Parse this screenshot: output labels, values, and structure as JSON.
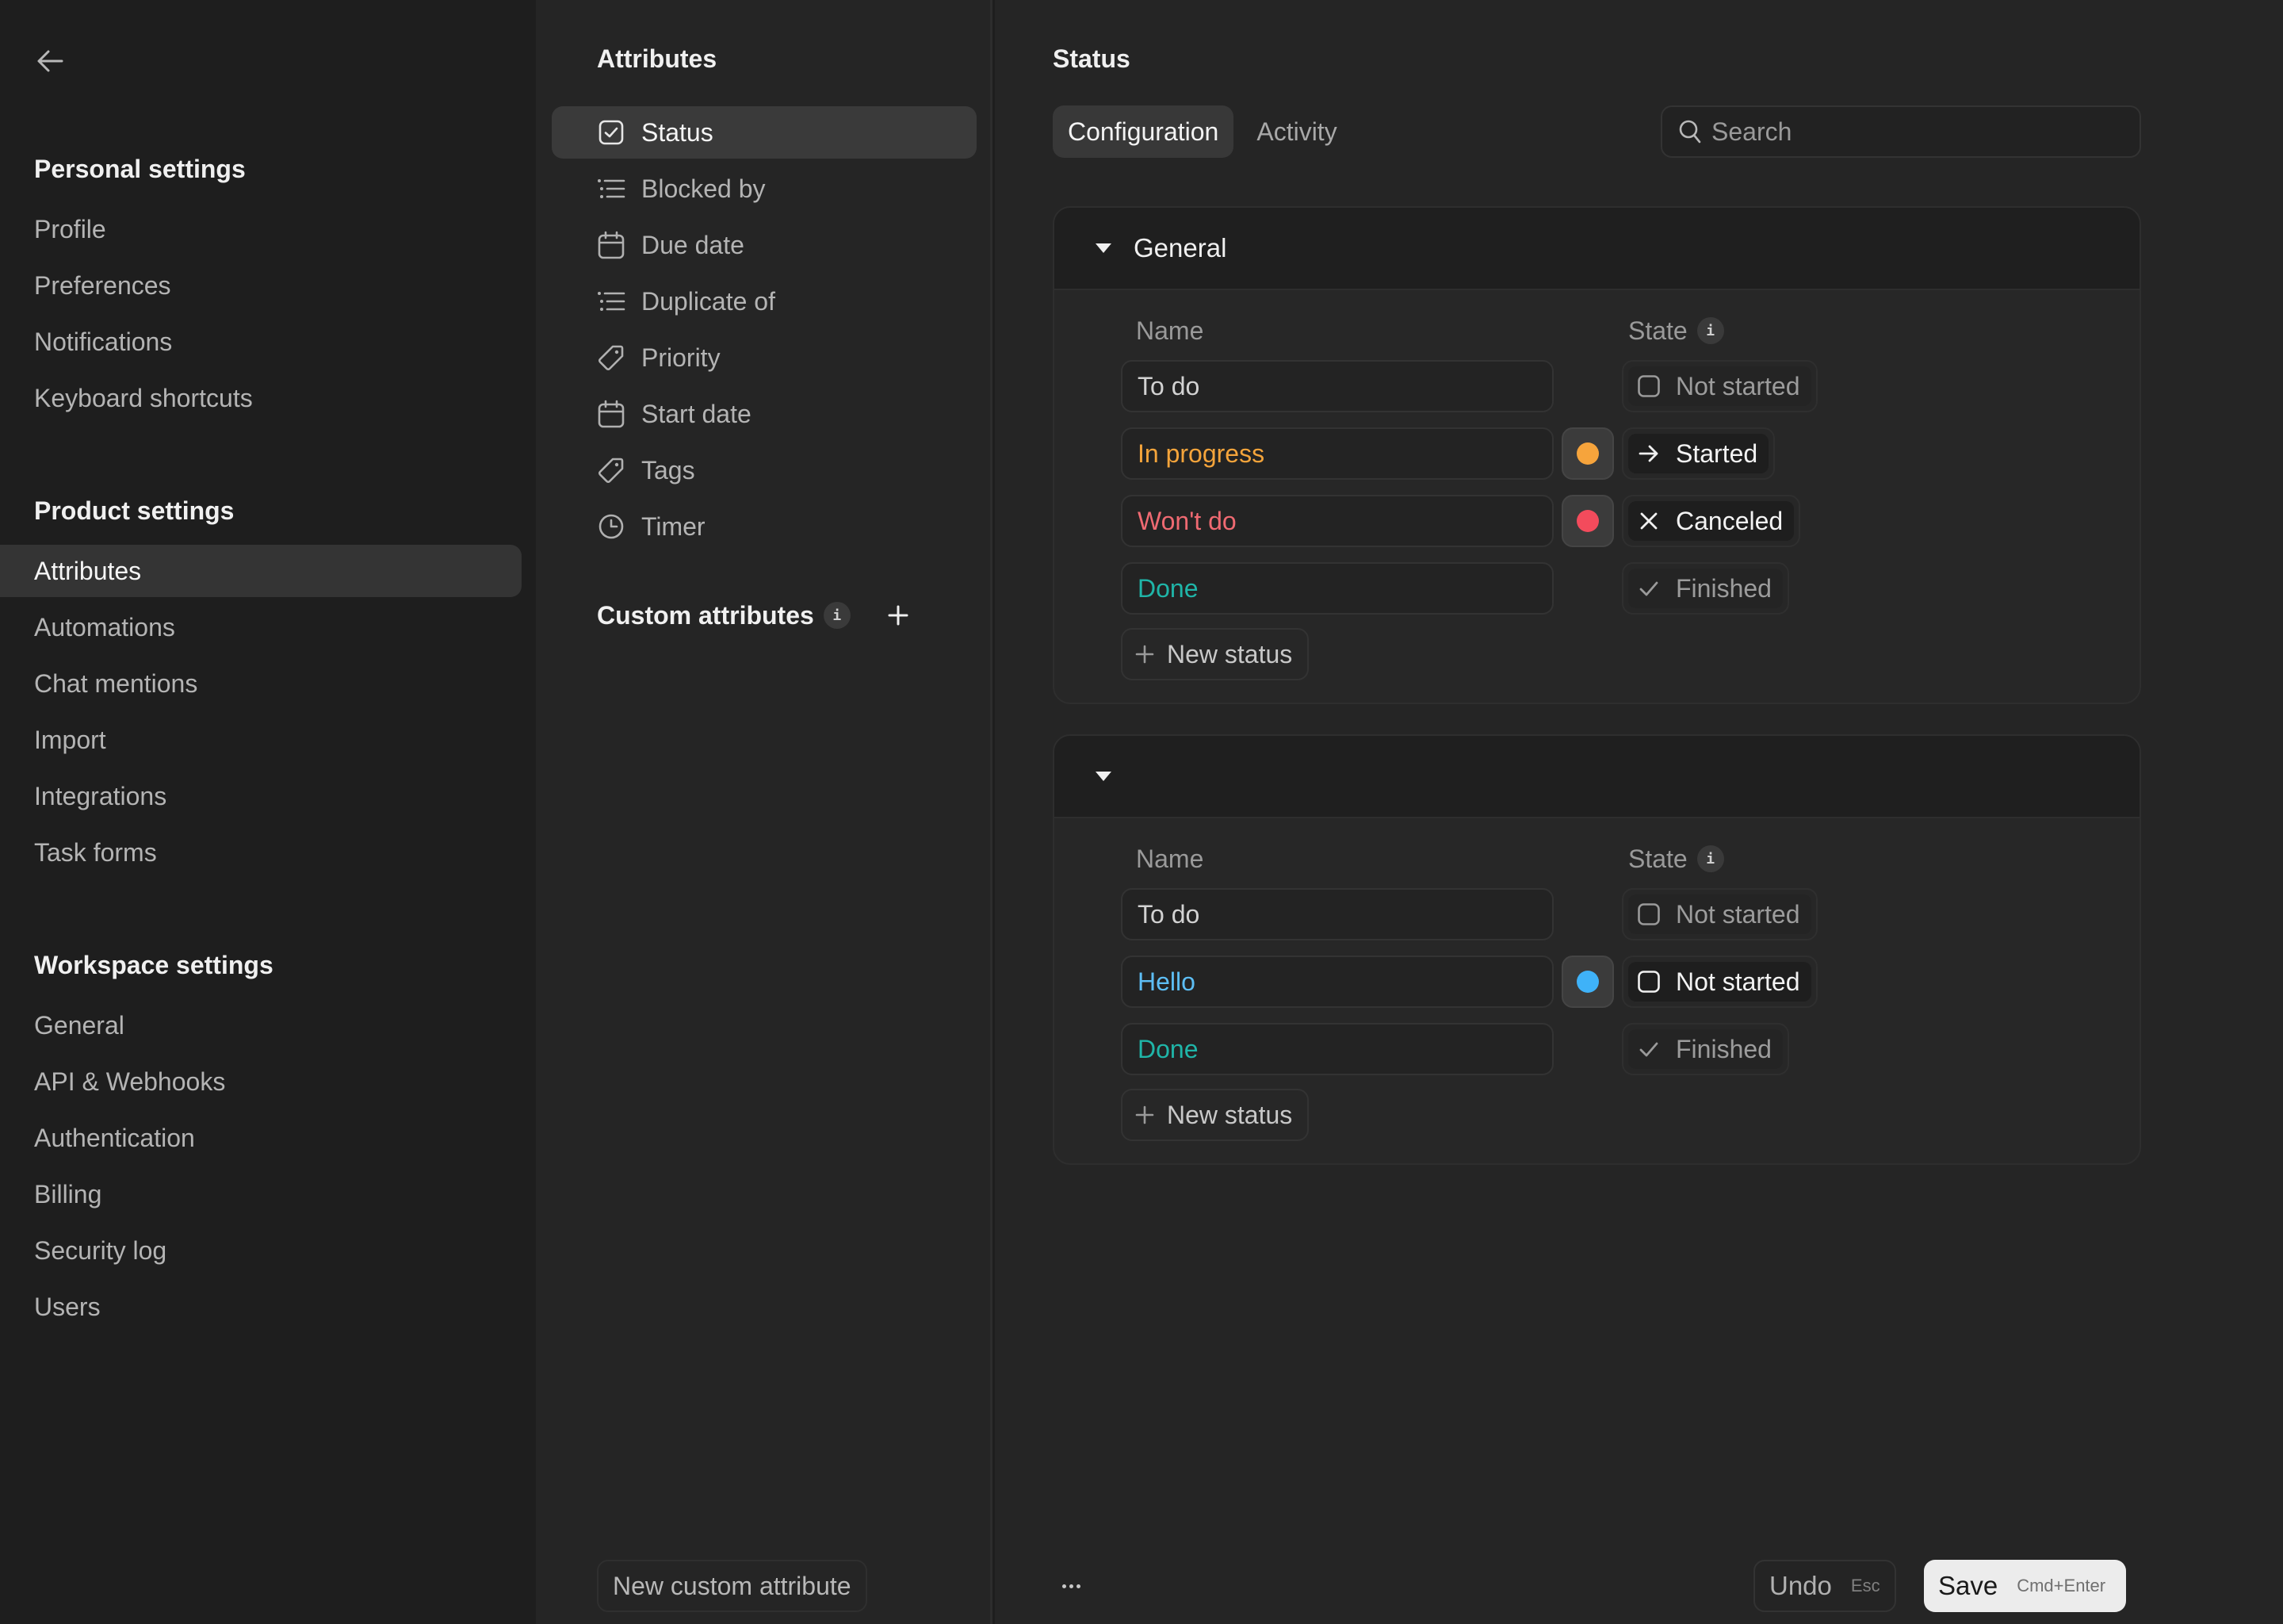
{
  "sidebar": {
    "back_label": "Back",
    "sections": [
      {
        "heading": "Personal settings",
        "items": [
          "Profile",
          "Preferences",
          "Notifications",
          "Keyboard shortcuts"
        ]
      },
      {
        "heading": "Product settings",
        "items": [
          "Attributes",
          "Automations",
          "Chat mentions",
          "Import",
          "Integrations",
          "Task forms"
        ],
        "active": "Attributes"
      },
      {
        "heading": "Workspace settings",
        "items": [
          "General",
          "API & Webhooks",
          "Authentication",
          "Billing",
          "Security log",
          "Users"
        ]
      }
    ]
  },
  "attributes_panel": {
    "title": "Attributes",
    "items": [
      {
        "label": "Status",
        "icon": "checkbox-icon",
        "active": true
      },
      {
        "label": "Blocked by",
        "icon": "list-icon"
      },
      {
        "label": "Due date",
        "icon": "calendar-icon"
      },
      {
        "label": "Duplicate of",
        "icon": "list-icon"
      },
      {
        "label": "Priority",
        "icon": "tag-icon"
      },
      {
        "label": "Start date",
        "icon": "calendar-icon"
      },
      {
        "label": "Tags",
        "icon": "tag-icon"
      },
      {
        "label": "Timer",
        "icon": "clock-icon"
      }
    ],
    "custom_title": "Custom attributes",
    "info_glyph": "i",
    "new_custom_button": "New custom attribute"
  },
  "main": {
    "title": "Status",
    "tabs": [
      {
        "label": "Configuration",
        "active": true
      },
      {
        "label": "Activity",
        "active": false
      }
    ],
    "search": {
      "placeholder": "Search",
      "value": ""
    },
    "columns": {
      "name": "Name",
      "state": "State"
    },
    "new_status_label": "New status",
    "groups": [
      {
        "title": "General",
        "statuses": [
          {
            "name": "To do",
            "name_color": "#d2d2d2",
            "dot_color": null,
            "state": "Not started",
            "state_icon": "empty-checkbox-icon",
            "emphasis": "muted"
          },
          {
            "name": "In progress",
            "name_color": "#f4a43b",
            "dot_color": "#f6a43c",
            "state": "Started",
            "state_icon": "arrow-right-icon",
            "emphasis": "bright"
          },
          {
            "name": "Won't do",
            "name_color": "#ef6a72",
            "dot_color": "#f34b5c",
            "state": "Canceled",
            "state_icon": "x-icon",
            "emphasis": "bright"
          },
          {
            "name": "Done",
            "name_color": "#1fb5a8",
            "dot_color": null,
            "state": "Finished",
            "state_icon": "check-icon",
            "emphasis": "muted"
          }
        ]
      },
      {
        "title": "",
        "statuses": [
          {
            "name": "To do",
            "name_color": "#d2d2d2",
            "dot_color": null,
            "state": "Not started",
            "state_icon": "empty-checkbox-icon",
            "emphasis": "muted"
          },
          {
            "name": "Hello",
            "name_color": "#5dbef5",
            "dot_color": "#3fb2f8",
            "state": "Not started",
            "state_icon": "empty-checkbox-icon",
            "emphasis": "bright"
          },
          {
            "name": "Done",
            "name_color": "#1fb5a8",
            "dot_color": null,
            "state": "Finished",
            "state_icon": "check-icon",
            "emphasis": "muted"
          }
        ]
      }
    ]
  },
  "footer": {
    "more_label": "More options",
    "undo": {
      "label": "Undo",
      "shortcut": "Esc"
    },
    "save": {
      "label": "Save",
      "shortcut": "Cmd+Enter"
    }
  }
}
